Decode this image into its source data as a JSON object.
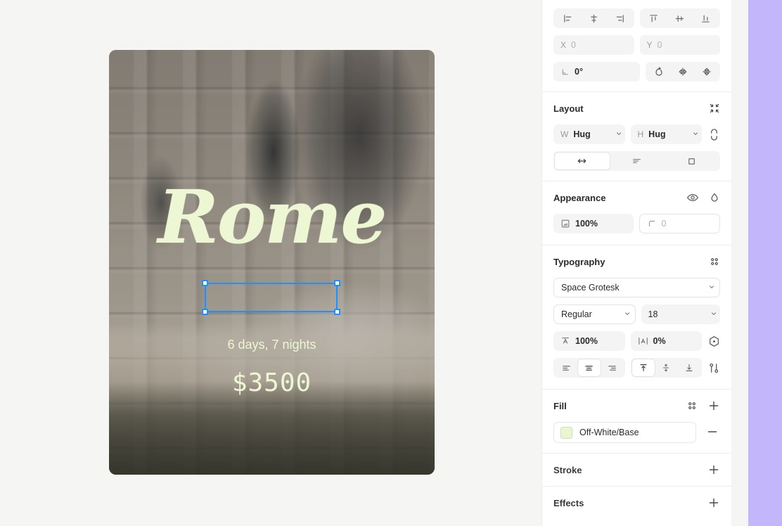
{
  "canvas": {
    "background_color": "#f5f5f4",
    "frame": {
      "name": "travel-card-frame",
      "corner_radius": 10,
      "image_subject": "Trevi Fountain, Rome",
      "texts": {
        "title": "Rome",
        "subtitle": "6 days, 7 nights",
        "price": "$3500"
      },
      "text_color": "#eef7d4"
    },
    "selection": {
      "selected_layer": "6 days, 7 nights",
      "handle_color": "#1e90ff"
    }
  },
  "panel": {
    "align": {
      "horizontal": [
        {
          "name": "align-left",
          "label": "Align left"
        },
        {
          "name": "align-center-horizontal",
          "label": "Align horizontal centers"
        },
        {
          "name": "align-right",
          "label": "Align right"
        }
      ],
      "vertical": [
        {
          "name": "align-top",
          "label": "Align top"
        },
        {
          "name": "align-center-vertical",
          "label": "Align vertical centers"
        },
        {
          "name": "align-bottom",
          "label": "Align bottom"
        }
      ]
    },
    "position": {
      "x_label": "X",
      "x_value": "0",
      "y_label": "Y",
      "y_value": "0",
      "rotation_value": "0°",
      "transform_actions": [
        {
          "name": "rotate",
          "label": "Rotate"
        },
        {
          "name": "flip-horizontal",
          "label": "Flip horizontal"
        },
        {
          "name": "flip-vertical",
          "label": "Flip vertical"
        }
      ]
    },
    "layout": {
      "title": "Layout",
      "collapse_label": "Collapse",
      "width_label": "W",
      "width_value": "Hug",
      "height_label": "H",
      "height_value": "Hug",
      "constrain_label": "Constrain proportions",
      "modes": [
        {
          "name": "auto-width",
          "label": "Auto width",
          "active": true
        },
        {
          "name": "auto-height",
          "label": "Auto height",
          "active": false
        },
        {
          "name": "fixed-size",
          "label": "Fixed size",
          "active": false
        }
      ]
    },
    "appearance": {
      "title": "Appearance",
      "visibility_label": "Toggle visibility",
      "blend_label": "Blend mode",
      "opacity_value": "100%",
      "corner_radius_value": "0"
    },
    "typography": {
      "title": "Typography",
      "options_label": "More options",
      "font_family": "Space Grotesk",
      "font_weight": "Regular",
      "font_size": "18",
      "line_height_value": "100%",
      "letter_spacing_value": "0%",
      "variable_label": "Font variables",
      "horizontal_align": [
        {
          "name": "text-align-left",
          "label": "Align left",
          "active": false
        },
        {
          "name": "text-align-center",
          "label": "Align center",
          "active": true
        },
        {
          "name": "text-align-right",
          "label": "Align right",
          "active": false
        }
      ],
      "vertical_align": [
        {
          "name": "text-valign-top",
          "label": "Align top",
          "active": true
        },
        {
          "name": "text-valign-middle",
          "label": "Align middle",
          "active": false
        },
        {
          "name": "text-valign-bottom",
          "label": "Align bottom",
          "active": false
        }
      ],
      "settings_label": "Type settings"
    },
    "fill": {
      "title": "Fill",
      "options_label": "Fill options",
      "add_label": "Add fill",
      "items": [
        {
          "name": "Off-White/Base",
          "color": "#eaf6cf",
          "remove_label": "Remove fill"
        }
      ]
    },
    "stroke": {
      "title": "Stroke",
      "add_label": "Add stroke"
    },
    "effects": {
      "title": "Effects",
      "add_label": "Add effect"
    }
  },
  "accent": {
    "purple_strip": "#c3b6fb"
  }
}
